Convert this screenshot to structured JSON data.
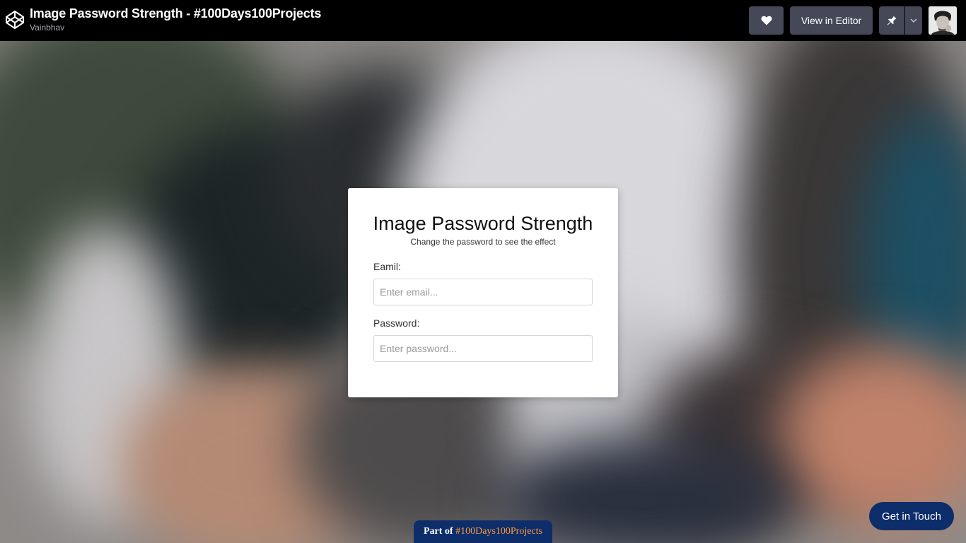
{
  "header": {
    "title": "Image Password Strength - #100Days100Projects",
    "author": "Vainbhav",
    "view_in_editor_label": "View in Editor",
    "logo_icon": "codepen-logo-icon",
    "heart_icon": "heart-icon",
    "pin_icon": "pin-icon",
    "dropdown_icon": "chevron-down-icon"
  },
  "card": {
    "title": "Image Password Strength",
    "subtitle": "Change the password to see the effect",
    "email_label": "Eamil:",
    "email_placeholder": "Enter email...",
    "email_value": "",
    "password_label": "Password:",
    "password_placeholder": "Enter password...",
    "password_value": ""
  },
  "badge": {
    "prefix": "Part of",
    "hashtag": "#100Days100Projects"
  },
  "contact": {
    "label": "Get in Touch"
  },
  "colors": {
    "topbar_bg": "#000000",
    "button_bg": "#444857",
    "badge_bg": "#0d2d6b",
    "hashtag": "#ff9c3a"
  }
}
